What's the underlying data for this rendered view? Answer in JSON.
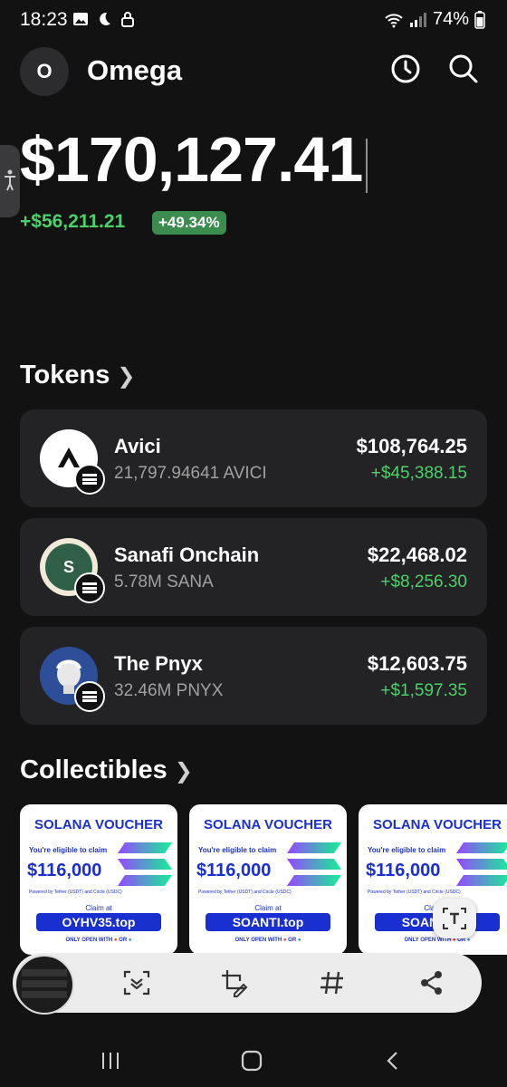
{
  "status_bar": {
    "time": "18:23",
    "battery": "74%",
    "icons": [
      "image-icon",
      "moon-icon",
      "lock-icon",
      "wifi-call-icon",
      "signal-icon",
      "battery-icon"
    ]
  },
  "header": {
    "avatar_letter": "O",
    "wallet_name": "Omega",
    "icons": [
      "history-icon",
      "search-icon"
    ]
  },
  "balance": {
    "total": "$170,127.41",
    "change": "+$56,211.21",
    "change_pct": "+49.34%"
  },
  "tokens": {
    "title": "Tokens",
    "items": [
      {
        "name": "Avici",
        "amount": "21,797.94641 AVICI",
        "value": "$108,764.25",
        "gain": "+$45,388.15",
        "icon": "avici-logo"
      },
      {
        "name": "Sanafi Onchain",
        "amount": "5.78M SANA",
        "value": "$22,468.02",
        "gain": "+$8,256.30",
        "icon": "sanafi-logo",
        "icon_letter": "S"
      },
      {
        "name": "The Pnyx",
        "amount": "32.46M PNYX",
        "value": "$12,603.75",
        "gain": "+$1,597.35",
        "icon": "pnyx-logo"
      }
    ]
  },
  "collectibles": {
    "title": "Collectibles",
    "items": [
      {
        "title": "SOLANA VOUCHER",
        "eligible": "You're eligible to claim",
        "amount": "$116,000",
        "powered": "Powered by Tether (USDT) and Circle (USDC)",
        "claim": "Claim at",
        "url": "OYHV35.top",
        "only": "ONLY OPEN WITH",
        "or": "OR"
      },
      {
        "title": "SOLANA VOUCHER",
        "eligible": "You're eligible to claim",
        "amount": "$116,000",
        "powered": "Powered by Tether (USDT) and Circle (USDC)",
        "claim": "Claim at",
        "url": "SOANTI.top",
        "only": "ONLY OPEN WITH",
        "or": "OR"
      },
      {
        "title": "SOLANA VOUCHER",
        "eligible": "You're eligible to claim",
        "amount": "$116,000",
        "powered": "Powered by Tether (USDT) and Circle (USDC)",
        "claim": "Claim at",
        "url": "SOANTI.top",
        "only": "ONLY OPEN WITH",
        "or": "OR"
      }
    ]
  },
  "screenshot_toolbar": {
    "buttons": [
      "scroll-capture-icon",
      "crop-edit-icon",
      "hashtag-icon",
      "share-icon"
    ]
  },
  "nav_bar": {
    "buttons": [
      "recents-icon",
      "home-icon",
      "back-icon"
    ]
  },
  "colors": {
    "background": "#121212",
    "card": "#232325",
    "gain_green": "#4cd06a",
    "badge_green": "#3c8c4f",
    "voucher_blue": "#1a2fd0"
  }
}
